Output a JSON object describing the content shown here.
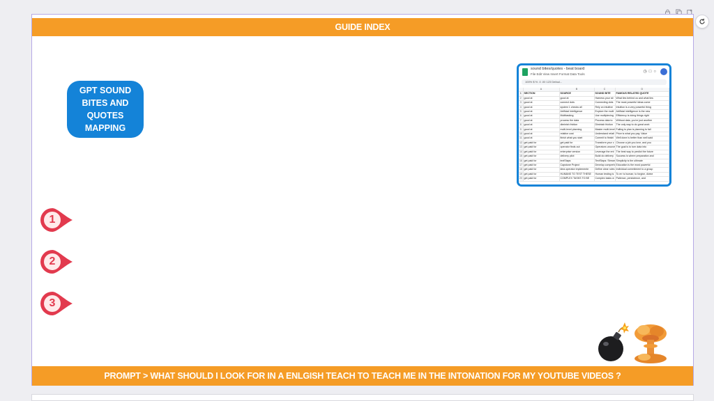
{
  "header": {
    "title": "GUIDE INDEX"
  },
  "tag": {
    "text": "GPT SOUND BITES AND QUOTES MAPPING",
    "color": "#1483d8"
  },
  "markers": [
    "1",
    "2",
    "3"
  ],
  "footer": {
    "prompt": "PROMPT > WHAT SHOULD I LOOK FOR IN A ENLGISH TEACH TO TEACH ME IN THE INTONATION FOR MY YOUTUBE VIDEOS ?"
  },
  "colors": {
    "banner": "#f59c26",
    "marker": "#e23a4e",
    "accent": "#1483d8"
  },
  "icons": {
    "top": [
      "lock-icon",
      "duplicate-icon",
      "add-page-icon"
    ],
    "refresh": "refresh-icon",
    "emojis": [
      "bomb-icon",
      "explosion-icon"
    ]
  },
  "spreadsheet": {
    "filename": "sound bites/quotes - beat board",
    "menu": "File  Edit  View  Insert  Format  Data  Tools",
    "toolbar": "100%   $  %  .0  .00  123   Defaul...",
    "column_letters": [
      "",
      "A",
      "B",
      "C",
      "D"
    ],
    "headers": [
      "SECTION",
      "SOURCE",
      "SOUND BITE",
      "FAMOUS RELATED QUOTE"
    ],
    "rows": [
      [
        "good at",
        "good at",
        "Harness your str",
        "What lies behind us and what lies"
      ],
      [
        "good at",
        "connect dots",
        "Connecting dots",
        "The most powerful ideas come"
      ],
      [
        "good at",
        "system 1 checks all",
        "Rely on intuitive",
        "Intuition is a very powerful thing"
      ],
      [
        "good at",
        "Artificial Intelligence",
        "Explore the multi",
        "Artificial intelligence is the new"
      ],
      [
        "good at",
        "Multitasking",
        "Use multiplexing",
        "Efficiency is doing things right"
      ],
      [
        "good at",
        "process the data",
        "Process data to",
        "Without data, you're just another"
      ],
      [
        "good at",
        "diminish friction",
        "Diminish friction",
        "The only way to do great work"
      ],
      [
        "good at",
        "multi-level planning",
        "Master multi-level",
        "Failing to plan is planning to fail"
      ],
      [
        "good at",
        "relative cost",
        "Understand relati",
        "Price is what you pay. Value"
      ],
      [
        "good at",
        "finish what you start",
        "Commit to finishi",
        "Well done is better than well said"
      ],
      [
        "get paid for",
        "get paid for",
        "Transform your c",
        "Choose a job you love, and you"
      ],
      [
        "get paid for",
        "operator finds out",
        "Operators uncove",
        "The goal is to turn data into"
      ],
      [
        "get paid for",
        "enterprise version",
        "Leverage the ent",
        "The best way to predict the future"
      ],
      [
        "get paid for",
        "delivery pilot",
        "Build do delivery",
        "Success is where preparation and"
      ],
      [
        "get paid for",
        "textStaps",
        "TextStaps: Stream",
        "Simplicity is the ultimate"
      ],
      [
        "get paid for",
        "Capstone Project",
        "Develop comprehe",
        "Education is the most powerful"
      ],
      [
        "get paid for",
        "idea operator implemente",
        "Define clear rules",
        "Individual commitment to a group"
      ],
      [
        "get paid for",
        "HUMANS TO TEST THESE",
        "Human testing is",
        "To err is human; to forgive, divine"
      ],
      [
        "get paid for",
        "COMPLEX TASKS TO BE",
        "Complex tasks w",
        "Patience, persistence, and"
      ]
    ]
  }
}
